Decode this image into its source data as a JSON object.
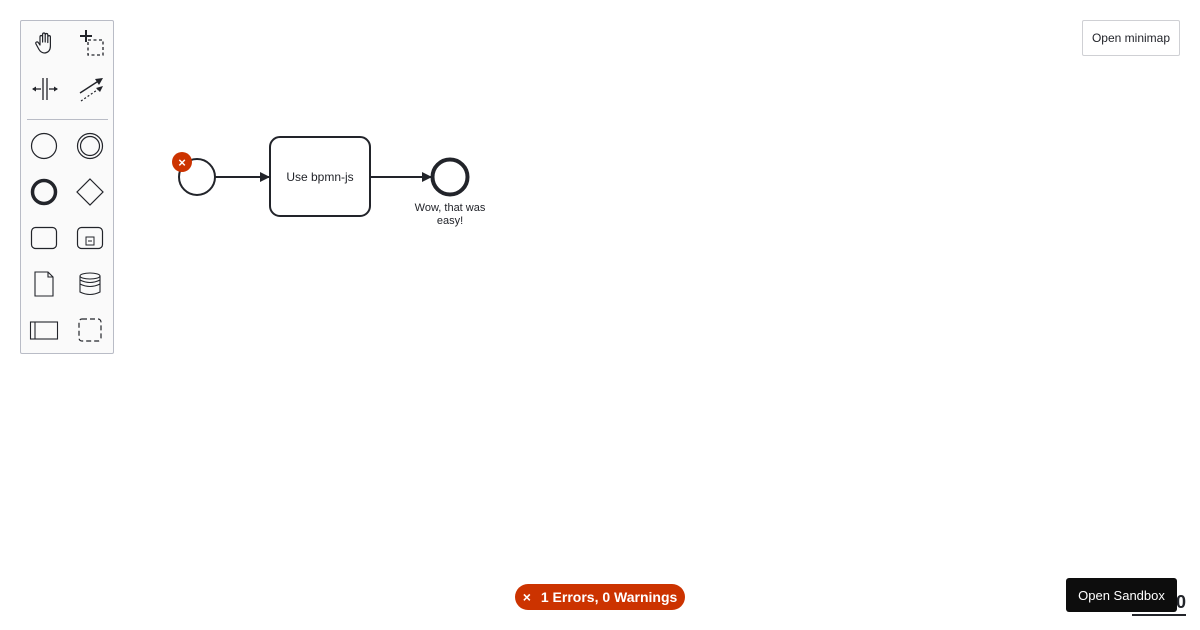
{
  "palette": {
    "tools": [
      {
        "name": "hand-tool",
        "icon": "hand-icon"
      },
      {
        "name": "lasso-tool",
        "icon": "lasso-icon"
      },
      {
        "name": "space-tool",
        "icon": "space-icon"
      },
      {
        "name": "global-connect-tool",
        "icon": "connect-icon"
      },
      {
        "name": "create-start-event",
        "icon": "start-event-icon"
      },
      {
        "name": "create-intermediate-event",
        "icon": "intermediate-event-icon"
      },
      {
        "name": "create-end-event",
        "icon": "end-event-icon"
      },
      {
        "name": "create-gateway",
        "icon": "gateway-icon"
      },
      {
        "name": "create-task",
        "icon": "task-icon"
      },
      {
        "name": "create-subprocess",
        "icon": "subprocess-icon"
      },
      {
        "name": "create-data-object",
        "icon": "data-object-icon"
      },
      {
        "name": "create-data-store",
        "icon": "data-store-icon"
      },
      {
        "name": "create-participant",
        "icon": "participant-icon"
      },
      {
        "name": "create-group",
        "icon": "group-icon"
      }
    ]
  },
  "diagram": {
    "task_label": "Use bpmn-js",
    "end_event_label": "Wow, that was easy!",
    "error_marker": "×"
  },
  "minimap": {
    "label": "Open minimap"
  },
  "linting": {
    "icon": "×",
    "summary": "1 Errors, 0 Warnings",
    "color": "#cc3300"
  },
  "sandbox": {
    "label": "Open Sandbox"
  },
  "logo": {
    "text": "0"
  }
}
